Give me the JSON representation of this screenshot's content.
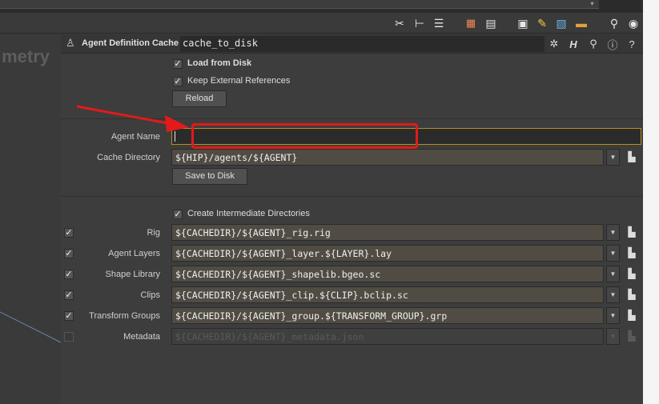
{
  "top_strip": {
    "dropdown_glyph": "▾"
  },
  "toolbar": {
    "icons": [
      "tools-icon",
      "tree-icon",
      "list-view-icon",
      "grid-color-icon",
      "table-view-icon",
      "node-info-icon",
      "sticky-note-icon",
      "image-icon",
      "box-icon",
      "search-icon",
      "eye-icon"
    ]
  },
  "network": {
    "context_label": "metry"
  },
  "header": {
    "node_type": "Agent Definition Cache",
    "node_name": "cache_to_disk",
    "icons": [
      "gear-icon",
      "help-h-icon",
      "search-icon",
      "info-icon",
      "question-icon"
    ]
  },
  "params": {
    "load_from_disk": {
      "label": "Load from Disk",
      "checked": true
    },
    "keep_external_refs": {
      "label": "Keep External References",
      "checked": true
    },
    "reload_button": "Reload",
    "agent_name": {
      "label": "Agent Name",
      "value": ""
    },
    "cache_directory": {
      "label": "Cache Directory",
      "value": "${HIP}/agents/${AGENT}"
    },
    "save_button": "Save to Disk",
    "create_dirs": {
      "label": "Create Intermediate Directories",
      "checked": true
    },
    "rows": [
      {
        "label": "Rig",
        "value": "${CACHEDIR}/${AGENT}_rig.rig",
        "enabled": true
      },
      {
        "label": "Agent Layers",
        "value": "${CACHEDIR}/${AGENT}_layer.${LAYER}.lay",
        "enabled": true
      },
      {
        "label": "Shape Library",
        "value": "${CACHEDIR}/${AGENT}_shapelib.bgeo.sc",
        "enabled": true
      },
      {
        "label": "Clips",
        "value": "${CACHEDIR}/${AGENT}_clip.${CLIP}.bclip.sc",
        "enabled": true
      },
      {
        "label": "Transform Groups",
        "value": "${CACHEDIR}/${AGENT}_group.${TRANSFORM_GROUP}.grp",
        "enabled": true
      },
      {
        "label": "Metadata",
        "value": "${CACHEDIR}/${AGENT}_metadata.json",
        "enabled": false
      }
    ]
  },
  "annotation": {
    "color": "#e21a1a"
  }
}
